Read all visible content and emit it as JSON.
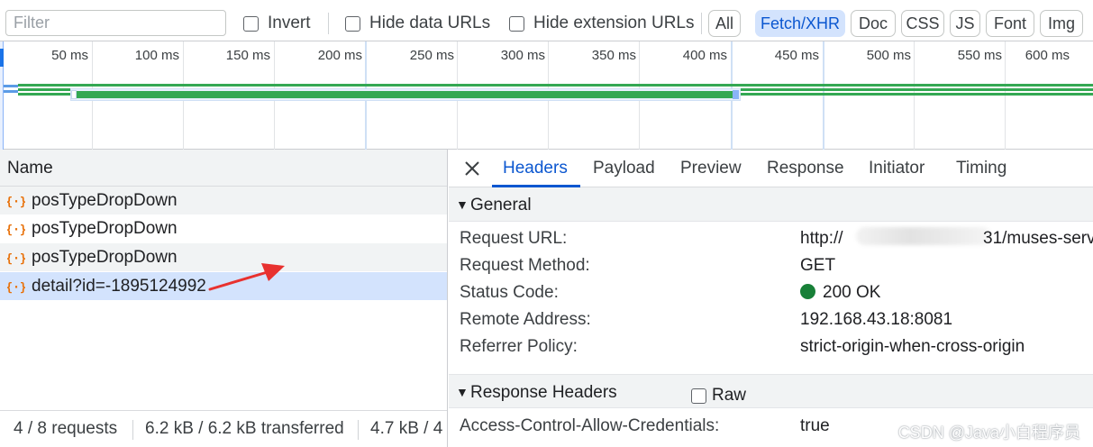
{
  "filterbar": {
    "filter_placeholder": "Filter",
    "invert_label": "Invert",
    "hide_data_urls_label": "Hide data URLs",
    "hide_extension_urls_label": "Hide extension URLs",
    "type_filters": [
      "All",
      "Fetch/XHR",
      "Doc",
      "CSS",
      "JS",
      "Font",
      "Img"
    ],
    "active_filter": "Fetch/XHR"
  },
  "overview": {
    "ticks": [
      "50 ms",
      "100 ms",
      "150 ms",
      "200 ms",
      "250 ms",
      "300 ms",
      "350 ms",
      "400 ms",
      "450 ms",
      "500 ms",
      "550 ms",
      "600 ms"
    ]
  },
  "requests": {
    "column_header": "Name",
    "rows": [
      {
        "name": "posTypeDropDown"
      },
      {
        "name": "posTypeDropDown"
      },
      {
        "name": "posTypeDropDown"
      },
      {
        "name": "detail?id=-1895124992",
        "selected": true
      }
    ]
  },
  "statusbar": {
    "requests": "4 / 8 requests",
    "transferred": "6.2 kB / 6.2 kB transferred",
    "resources": "4.7 kB / 4"
  },
  "details": {
    "tabs": [
      "Headers",
      "Payload",
      "Preview",
      "Response",
      "Initiator",
      "Timing"
    ],
    "active_tab": "Headers",
    "general": {
      "title": "General",
      "rows": [
        {
          "key": "Request URL:",
          "value_start": "http://",
          "value_end": "31/muses-serv"
        },
        {
          "key": "Request Method:",
          "value": "GET"
        },
        {
          "key": "Status Code:",
          "value": "200 OK"
        },
        {
          "key": "Remote Address:",
          "value": "192.168.43.18:8081"
        },
        {
          "key": "Referrer Policy:",
          "value": "strict-origin-when-cross-origin"
        }
      ]
    },
    "response_headers": {
      "title": "Response Headers",
      "raw_label": "Raw",
      "rows": [
        {
          "key": "Access-Control-Allow-Credentials:",
          "value": "true"
        }
      ]
    }
  },
  "watermark": "CSDN @Java小白程序员",
  "colors": {
    "accent": "#0b57d0",
    "selected_row": "#d3e3fd",
    "status_ok": "#188038",
    "timeline_green": "#34a853",
    "annotation_arrow": "#e8312f",
    "xhr_icon": "#e8710a"
  }
}
